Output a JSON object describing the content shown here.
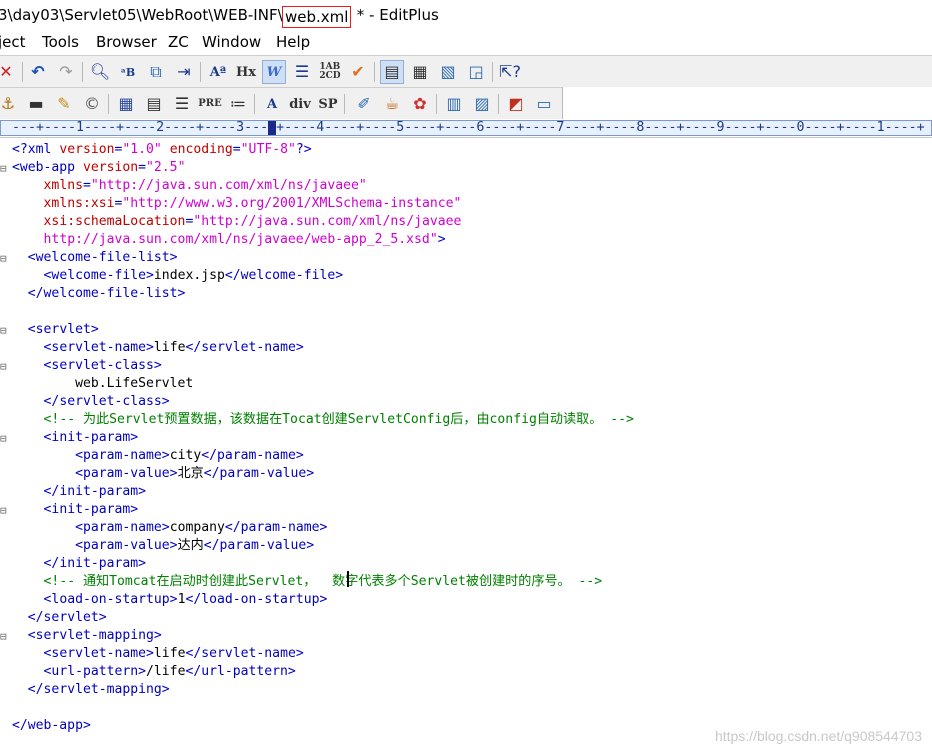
{
  "window": {
    "title_path": "3\\day03\\Servlet05\\WebRoot\\WEB-INF\\",
    "title_file": "web.xml",
    "title_suffix": " * - EditPlus"
  },
  "menu": [
    "ject",
    "Tools",
    "Browser",
    "ZC",
    "Window",
    "Help"
  ],
  "toolbar1_icons": [
    "close-icon",
    "undo-icon",
    "redo-icon",
    "find-icon",
    "replace-icon",
    "find-in-files-icon",
    "goto-line-icon",
    "font-icon",
    "hx-icon",
    "word-wrap-icon",
    "line-break-icon",
    "ab-spell-icon",
    "check-icon",
    "view-1-icon",
    "view-2-icon",
    "view-3-icon",
    "view-4-icon",
    "help-cursor-icon"
  ],
  "toolbar2_icons": [
    "anchor-icon",
    "hr-icon",
    "pencil-icon",
    "copyright-icon",
    "table-icon",
    "form-icon",
    "list-icon",
    "pre-icon",
    "ordered-list-icon",
    "a-icon",
    "div-icon",
    "sp-icon",
    "brush-icon",
    "cup-icon",
    "color-icon",
    "grid-icon",
    "layout-icon",
    "window-color-icon",
    "window-icon"
  ],
  "toolbar2_text": {
    "pre": "PRE",
    "div": "div",
    "sp": "SP",
    "hx": "Hx"
  },
  "ruler": "---+----1----+----2----+----3----+----4----+----5----+----6----+----7----+----8----+----9----+----0----+----1----+",
  "code": [
    {
      "fold": "",
      "segments": [
        [
          "tag",
          "<?xml "
        ],
        [
          "attr",
          "version"
        ],
        [
          "tag",
          "="
        ],
        [
          "val",
          "\"1.0\""
        ],
        [
          "tag",
          " "
        ],
        [
          "attr",
          "encoding"
        ],
        [
          "tag",
          "="
        ],
        [
          "val",
          "\"UTF-8\""
        ],
        [
          "tag",
          "?>"
        ]
      ]
    },
    {
      "fold": "⊟",
      "segments": [
        [
          "tag",
          "<web-app "
        ],
        [
          "attr",
          "version"
        ],
        [
          "tag",
          "="
        ],
        [
          "val",
          "\"2.5\""
        ]
      ]
    },
    {
      "fold": "",
      "segments": [
        [
          "txt",
          "    "
        ],
        [
          "attr",
          "xmlns"
        ],
        [
          "tag",
          "="
        ],
        [
          "val",
          "\"http://java.sun.com/xml/ns/javaee\""
        ]
      ]
    },
    {
      "fold": "",
      "segments": [
        [
          "txt",
          "    "
        ],
        [
          "attr",
          "xmlns:xsi"
        ],
        [
          "tag",
          "="
        ],
        [
          "val",
          "\"http://www.w3.org/2001/XMLSchema-instance\""
        ]
      ]
    },
    {
      "fold": "",
      "segments": [
        [
          "txt",
          "    "
        ],
        [
          "attr",
          "xsi:schemaLocation"
        ],
        [
          "tag",
          "="
        ],
        [
          "val",
          "\"http://java.sun.com/xml/ns/javaee"
        ]
      ]
    },
    {
      "fold": "",
      "segments": [
        [
          "txt",
          "    "
        ],
        [
          "val",
          "http://java.sun.com/xml/ns/javaee/web-app_2_5.xsd\""
        ],
        [
          "tag",
          ">"
        ]
      ]
    },
    {
      "fold": "⊟",
      "segments": [
        [
          "txt",
          "  "
        ],
        [
          "tag",
          "<welcome-file-list>"
        ]
      ]
    },
    {
      "fold": "",
      "segments": [
        [
          "txt",
          "    "
        ],
        [
          "tag",
          "<welcome-file>"
        ],
        [
          "txt",
          "index.jsp"
        ],
        [
          "tag",
          "</welcome-file>"
        ]
      ]
    },
    {
      "fold": "",
      "segments": [
        [
          "txt",
          "  "
        ],
        [
          "tag",
          "</welcome-file-list>"
        ]
      ]
    },
    {
      "fold": "",
      "segments": []
    },
    {
      "fold": "⊟",
      "segments": [
        [
          "txt",
          "  "
        ],
        [
          "tag",
          "<servlet>"
        ]
      ]
    },
    {
      "fold": "",
      "segments": [
        [
          "txt",
          "    "
        ],
        [
          "tag",
          "<servlet-name>"
        ],
        [
          "txt",
          "life"
        ],
        [
          "tag",
          "</servlet-name>"
        ]
      ]
    },
    {
      "fold": "⊟",
      "segments": [
        [
          "txt",
          "    "
        ],
        [
          "tag",
          "<servlet-class>"
        ]
      ]
    },
    {
      "fold": "",
      "segments": [
        [
          "txt",
          "        web.LifeServlet"
        ]
      ]
    },
    {
      "fold": "",
      "segments": [
        [
          "txt",
          "    "
        ],
        [
          "tag",
          "</servlet-class>"
        ]
      ]
    },
    {
      "fold": "",
      "segments": [
        [
          "txt",
          "    "
        ],
        [
          "cmt",
          "<!-- 为此Servlet预置数据，该数据在Tocat创建ServletConfig后，由config自动读取。 -->"
        ]
      ]
    },
    {
      "fold": "⊟",
      "segments": [
        [
          "txt",
          "    "
        ],
        [
          "tag",
          "<init-param>"
        ]
      ]
    },
    {
      "fold": "",
      "segments": [
        [
          "txt",
          "        "
        ],
        [
          "tag",
          "<param-name>"
        ],
        [
          "txt",
          "city"
        ],
        [
          "tag",
          "</param-name>"
        ]
      ]
    },
    {
      "fold": "",
      "segments": [
        [
          "txt",
          "        "
        ],
        [
          "tag",
          "<param-value>"
        ],
        [
          "txt",
          "北京"
        ],
        [
          "tag",
          "</param-value>"
        ]
      ]
    },
    {
      "fold": "",
      "segments": [
        [
          "txt",
          "    "
        ],
        [
          "tag",
          "</init-param>"
        ]
      ]
    },
    {
      "fold": "⊟",
      "segments": [
        [
          "txt",
          "    "
        ],
        [
          "tag",
          "<init-param>"
        ]
      ]
    },
    {
      "fold": "",
      "segments": [
        [
          "txt",
          "        "
        ],
        [
          "tag",
          "<param-name>"
        ],
        [
          "txt",
          "company"
        ],
        [
          "tag",
          "</param-name>"
        ]
      ]
    },
    {
      "fold": "",
      "segments": [
        [
          "txt",
          "        "
        ],
        [
          "tag",
          "<param-value>"
        ],
        [
          "txt",
          "达内"
        ],
        [
          "tag",
          "</param-value>"
        ]
      ]
    },
    {
      "fold": "",
      "segments": [
        [
          "txt",
          "    "
        ],
        [
          "tag",
          "</init-param>"
        ]
      ]
    },
    {
      "fold": "",
      "segments": [
        [
          "txt",
          "    "
        ],
        [
          "cmt",
          "<!-- 通知Tomcat在启动时创建此Servlet，  数字代表多个Servlet被创建时的序号。 -->"
        ]
      ]
    },
    {
      "fold": "",
      "segments": [
        [
          "txt",
          "    "
        ],
        [
          "tag",
          "<load-on-startup>"
        ],
        [
          "txt",
          "1"
        ],
        [
          "tag",
          "</load-on-startup>"
        ]
      ]
    },
    {
      "fold": "",
      "segments": [
        [
          "txt",
          "  "
        ],
        [
          "tag",
          "</servlet>"
        ]
      ]
    },
    {
      "fold": "⊟",
      "segments": [
        [
          "txt",
          "  "
        ],
        [
          "tag",
          "<servlet-mapping>"
        ]
      ]
    },
    {
      "fold": "",
      "segments": [
        [
          "txt",
          "    "
        ],
        [
          "tag",
          "<servlet-name>"
        ],
        [
          "txt",
          "life"
        ],
        [
          "tag",
          "</servlet-name>"
        ]
      ]
    },
    {
      "fold": "",
      "segments": [
        [
          "txt",
          "    "
        ],
        [
          "tag",
          "<url-pattern>"
        ],
        [
          "txt",
          "/life"
        ],
        [
          "tag",
          "</url-pattern>"
        ]
      ]
    },
    {
      "fold": "",
      "segments": [
        [
          "txt",
          "  "
        ],
        [
          "tag",
          "</servlet-mapping>"
        ]
      ]
    },
    {
      "fold": "",
      "segments": []
    },
    {
      "fold": "",
      "segments": [
        [
          "tag",
          "</web-app>"
        ]
      ]
    }
  ],
  "watermark": "https://blog.csdn.net/q908544703",
  "colors": {
    "tag": "#0000c0",
    "attr": "#c00000",
    "value": "#d000d0",
    "comment": "#008000",
    "highlight_box": "#e02020"
  }
}
